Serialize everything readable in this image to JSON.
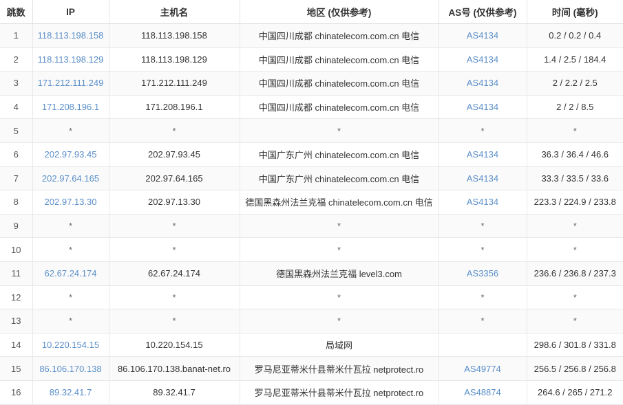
{
  "table": {
    "columns": [
      {
        "key": "hop",
        "label": "跳数"
      },
      {
        "key": "ip",
        "label": "IP"
      },
      {
        "key": "host",
        "label": "主机名"
      },
      {
        "key": "geo",
        "label": "地区 (仅供参考)"
      },
      {
        "key": "as",
        "label": "AS号 (仅供参考)"
      },
      {
        "key": "time",
        "label": "时间 (毫秒)"
      }
    ],
    "link_color": "#5b8fc9",
    "stripe_color": "#fafafa",
    "border_color": "#e8e8e8",
    "placeholder": "*",
    "rows": [
      {
        "hop": "1",
        "ip": "118.113.198.158",
        "host": "118.113.198.158",
        "geo": "中国四川成都 chinatelecom.com.cn 电信",
        "as": "AS4134",
        "time": "0.2 / 0.2 / 0.4"
      },
      {
        "hop": "2",
        "ip": "118.113.198.129",
        "host": "118.113.198.129",
        "geo": "中国四川成都 chinatelecom.com.cn 电信",
        "as": "AS4134",
        "time": "1.4 / 2.5 / 184.4"
      },
      {
        "hop": "3",
        "ip": "171.212.111.249",
        "host": "171.212.111.249",
        "geo": "中国四川成都 chinatelecom.com.cn 电信",
        "as": "AS4134",
        "time": "2 / 2.2 / 2.5"
      },
      {
        "hop": "4",
        "ip": "171.208.196.1",
        "host": "171.208.196.1",
        "geo": "中国四川成都 chinatelecom.com.cn 电信",
        "as": "AS4134",
        "time": "2 / 2 / 8.5"
      },
      {
        "hop": "5",
        "ip": "*",
        "host": "*",
        "geo": "*",
        "as": "*",
        "time": "*"
      },
      {
        "hop": "6",
        "ip": "202.97.93.45",
        "host": "202.97.93.45",
        "geo": "中国广东广州 chinatelecom.com.cn 电信",
        "as": "AS4134",
        "time": "36.3 / 36.4 / 46.6"
      },
      {
        "hop": "7",
        "ip": "202.97.64.165",
        "host": "202.97.64.165",
        "geo": "中国广东广州 chinatelecom.com.cn 电信",
        "as": "AS4134",
        "time": "33.3 / 33.5 / 33.6"
      },
      {
        "hop": "8",
        "ip": "202.97.13.30",
        "host": "202.97.13.30",
        "geo": "德国黑森州法兰克福 chinatelecom.com.cn 电信",
        "as": "AS4134",
        "time": "223.3 / 224.9 / 233.8"
      },
      {
        "hop": "9",
        "ip": "*",
        "host": "*",
        "geo": "*",
        "as": "*",
        "time": "*"
      },
      {
        "hop": "10",
        "ip": "*",
        "host": "*",
        "geo": "*",
        "as": "*",
        "time": "*"
      },
      {
        "hop": "11",
        "ip": "62.67.24.174",
        "host": "62.67.24.174",
        "geo": "德国黑森州法兰克福 level3.com",
        "as": "AS3356",
        "time": "236.6 / 236.8 / 237.3"
      },
      {
        "hop": "12",
        "ip": "*",
        "host": "*",
        "geo": "*",
        "as": "*",
        "time": "*"
      },
      {
        "hop": "13",
        "ip": "*",
        "host": "*",
        "geo": "*",
        "as": "*",
        "time": "*"
      },
      {
        "hop": "14",
        "ip": "10.220.154.15",
        "host": "10.220.154.15",
        "geo": "局域网",
        "as": "",
        "time": "298.6 / 301.8 / 331.8"
      },
      {
        "hop": "15",
        "ip": "86.106.170.138",
        "host": "86.106.170.138.banat-net.ro",
        "geo": "罗马尼亚蒂米什县蒂米什瓦拉 netprotect.ro",
        "as": "AS49774",
        "time": "256.5 / 256.8 / 256.8"
      },
      {
        "hop": "16",
        "ip": "89.32.41.7",
        "host": "89.32.41.7",
        "geo": "罗马尼亚蒂米什县蒂米什瓦拉 netprotect.ro",
        "as": "AS48874",
        "time": "264.6 / 265 / 271.2"
      }
    ]
  }
}
